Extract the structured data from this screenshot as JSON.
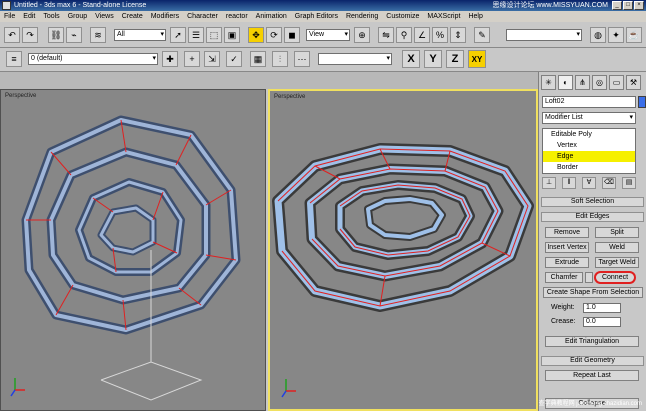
{
  "window": {
    "title": "Untitled - 3ds max 6 - Stand-alone License",
    "watermark": "思缘设计论坛 www.MISSYUAN.COM"
  },
  "menu": [
    "File",
    "Edit",
    "Tools",
    "Group",
    "Views",
    "Create",
    "Modifiers",
    "Character",
    "reactor",
    "Animation",
    "Graph Editors",
    "Rendering",
    "Customize",
    "MAXScript",
    "Help"
  ],
  "toolbar": {
    "selection_filter": "All",
    "ref_coord": "View",
    "named_selection": "",
    "layer": "0 (default)"
  },
  "axes": {
    "x": "X",
    "y": "Y",
    "z": "Z",
    "xy": "XY"
  },
  "viewports": {
    "left_label": "Perspective",
    "right_label": "Perspective"
  },
  "command_panel": {
    "object_name": "Loft02",
    "modifier_list": "Modifier List",
    "stack": [
      "Editable Poly",
      "Vertex",
      "Edge",
      "Border"
    ],
    "selected_stack_item": "Edge",
    "rollouts": {
      "soft_selection": "Soft Selection",
      "edit_edges": "Edit Edges",
      "edit_geometry": "Edit Geometry"
    },
    "buttons": {
      "remove": "Remove",
      "split": "Split",
      "insert_vertex": "Insert Vertex",
      "weld": "Weld",
      "extrude": "Extrude",
      "target_weld": "Target Weld",
      "chamfer": "Chamfer",
      "connect": "Connect",
      "create_shape": "Create Shape From Selection",
      "edit_triangulation": "Edit Triangulation",
      "repeat_last": "Repeat Last",
      "collapse": "Collapse"
    },
    "weight_label": "Weight:",
    "weight_value": "1.0",
    "crease_label": "Crease:",
    "crease_value": "0.0"
  },
  "bottom_watermark": "查字典教程网 jiaocheng.chazidian.com"
}
